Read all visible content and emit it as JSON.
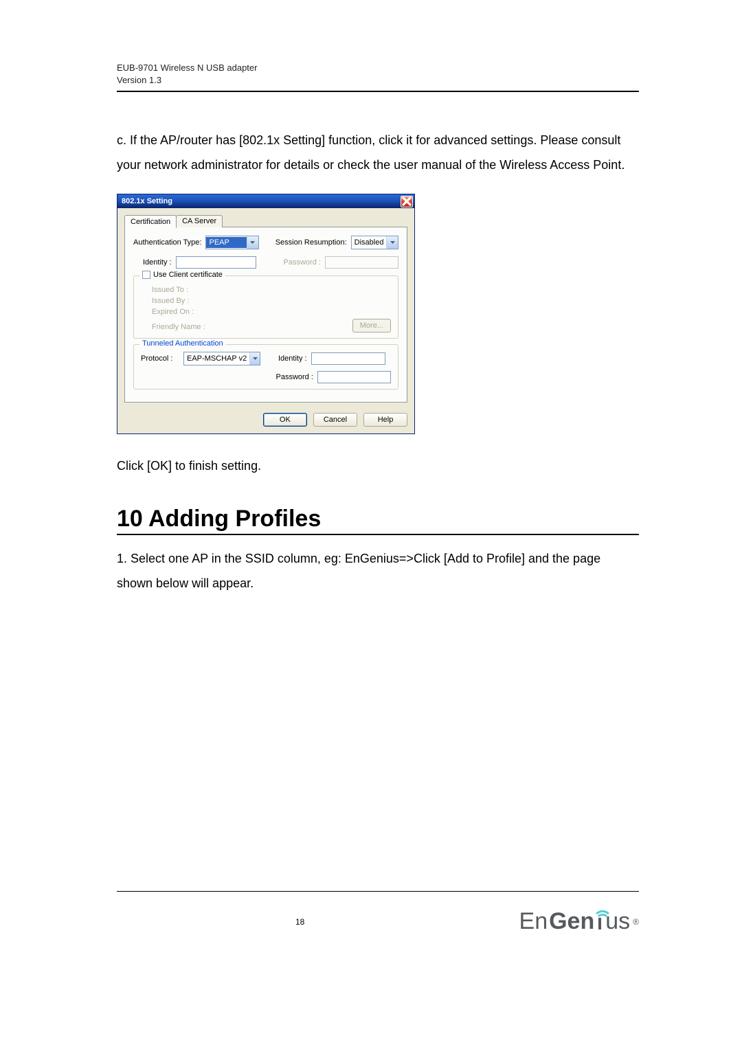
{
  "header": {
    "product": "EUB-9701 Wireless N USB adapter",
    "version": "Version 1.3"
  },
  "para_c": "c. If the AP/router has [802.1x Setting] function, click it for advanced settings. Please consult your network administrator for details or check the user manual of the Wireless Access Point.",
  "dialog": {
    "title": "802.1x Setting",
    "tabs": {
      "certification": "Certification",
      "ca_server": "CA Server"
    },
    "auth_type_label": "Authentication Type:",
    "auth_type_value": "PEAP",
    "session_label": "Session Resumption:",
    "session_value": "Disabled",
    "identity_label": "Identity :",
    "password_label": "Password :",
    "cert": {
      "legend": "Use Client certificate",
      "issued_to": "Issued To :",
      "issued_by": "Issued By :",
      "expired_on": "Expired On :",
      "friendly_name": "Friendly Name :",
      "more": "More..."
    },
    "tunnel": {
      "legend": "Tunneled Authentication",
      "protocol_label": "Protocol :",
      "protocol_value": "EAP-MSCHAP v2",
      "identity_label": "Identity :",
      "password_label": "Password :"
    },
    "buttons": {
      "ok": "OK",
      "cancel": "Cancel",
      "help": "Help"
    }
  },
  "para_click_ok": "Click [OK] to finish setting.",
  "section_heading": "10 Adding Profiles",
  "para_step1": "1. Select one AP in the SSID column, eg: EnGenius=>Click [Add to Profile] and the page shown below will appear.",
  "footer": {
    "page": "18",
    "brand_en": "En",
    "brand_gen": "Gen",
    "brand_us": "us",
    "reg": "®"
  }
}
